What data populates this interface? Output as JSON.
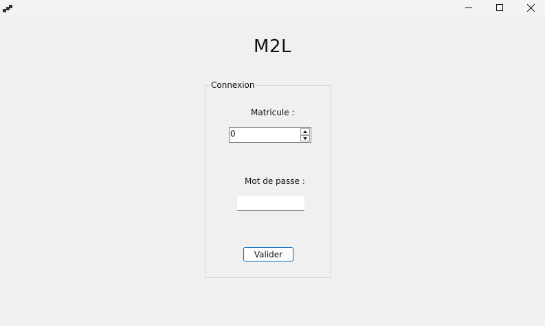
{
  "window": {
    "title": "",
    "controls": {
      "minimize_icon": "minimize-icon",
      "maximize_icon": "maximize-icon",
      "close_icon": "close-icon"
    }
  },
  "header": {
    "title": "M2L"
  },
  "login_group": {
    "legend": "Connexion",
    "matricule_label": "Matricule :",
    "matricule_value": "0",
    "password_label": "Mot de passe :",
    "password_value": "",
    "submit_label": "Valider"
  },
  "colors": {
    "background": "#f0f0f0",
    "accent": "#0067c0"
  }
}
